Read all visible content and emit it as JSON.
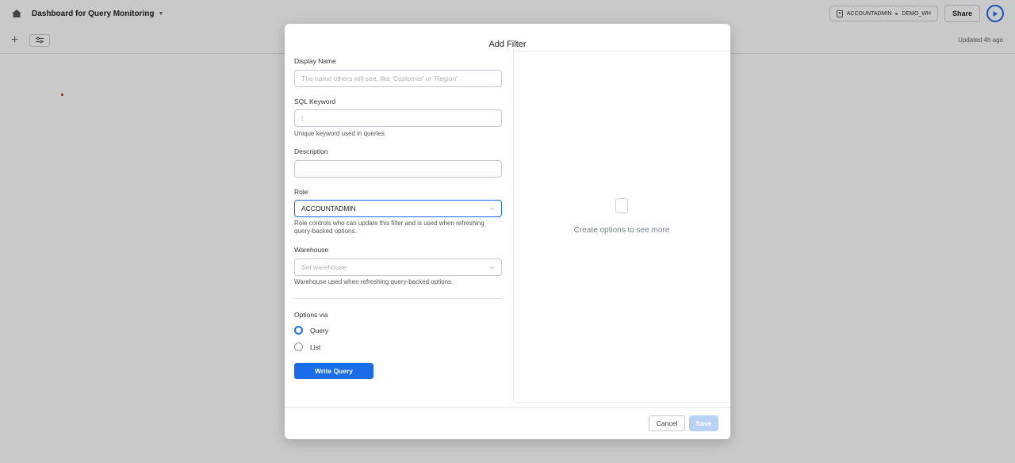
{
  "header": {
    "title": "Dashboard for Query Monitoring",
    "role": "ACCOUNTADMIN",
    "warehouse": "DEMO_WH",
    "share_label": "Share"
  },
  "subheader": {
    "updated": "Updated 4h ago"
  },
  "modal": {
    "title": "Add Filter",
    "display_name": {
      "label": "Display Name",
      "placeholder": "The name others will see, like 'Customer' or 'Region'."
    },
    "sql_keyword": {
      "label": "SQL Keyword",
      "value": ":",
      "help": "Unique keyword used in queries"
    },
    "description": {
      "label": "Description",
      "value": ""
    },
    "role": {
      "label": "Role",
      "value": "ACCOUNTADMIN",
      "help": "Role controls who can update this filter and is used when refreshing query-backed options."
    },
    "warehouse": {
      "label": "Warehouse",
      "placeholder": "Set warehouse",
      "help": "Warehouse used when refreshing query-backed options."
    },
    "options_via": {
      "label": "Options via",
      "choices": [
        "Query",
        "List"
      ],
      "selected": "Query"
    },
    "write_query_label": "Write Query",
    "empty_state": "Create options to see more",
    "cancel_label": "Cancel",
    "save_label": "Save"
  },
  "colors": {
    "accent": "#1a6ce8",
    "save_disabled": "#b8d2f6"
  }
}
